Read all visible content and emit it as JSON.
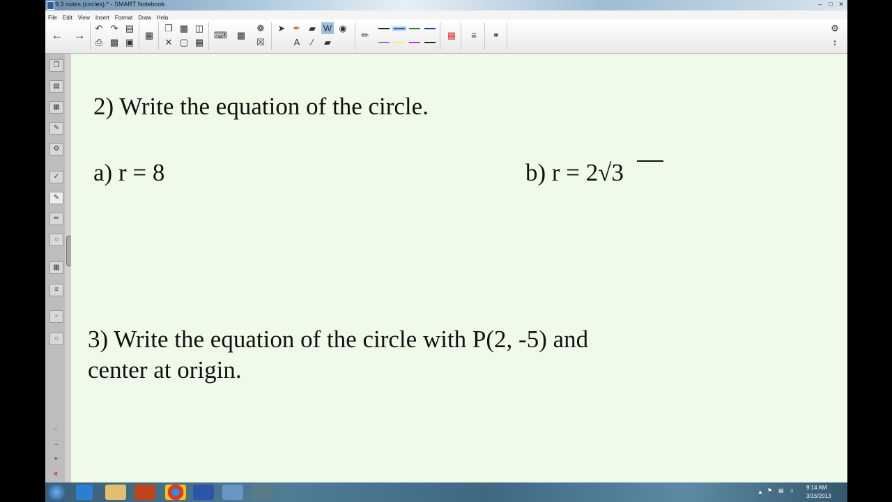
{
  "window": {
    "title": "9.3 notes (circles).* - SMART Notebook",
    "controls": [
      "–",
      "□",
      "✕"
    ]
  },
  "menu": [
    "File",
    "Edit",
    "View",
    "Insert",
    "Format",
    "Draw",
    "Help"
  ],
  "toolbar": {
    "icons": [
      "arrow-left-icon",
      "arrow-right-icon",
      "undo-icon",
      "redo-icon",
      "open-folder-icon",
      "display-icon",
      "copy-page-icon",
      "screen-shade-icon",
      "insert-table-icon",
      "keyboard-icon",
      "select-icon",
      "pen-icon",
      "eraser-icon",
      "fill-icon",
      "text-icon",
      "line-icon",
      "shape-icon",
      "color-picker-icon",
      "properties-icon",
      "settings-icon"
    ]
  },
  "page": {
    "q2_heading": "2) Write the equation of the circle.",
    "q2_part_a": "a) r = 8",
    "q2_part_b": "b) r = 2√3",
    "q3_line1": "3) Write the equation of the circle with P(2, -5) and",
    "q3_line2": "center at origin."
  },
  "taskbar": {
    "time": "9:14 AM",
    "date": "3/15/2013"
  },
  "colors": {
    "page_background": "#effbe8",
    "toolbar": "#f0f0f0",
    "taskbar": "#4a7590"
  }
}
